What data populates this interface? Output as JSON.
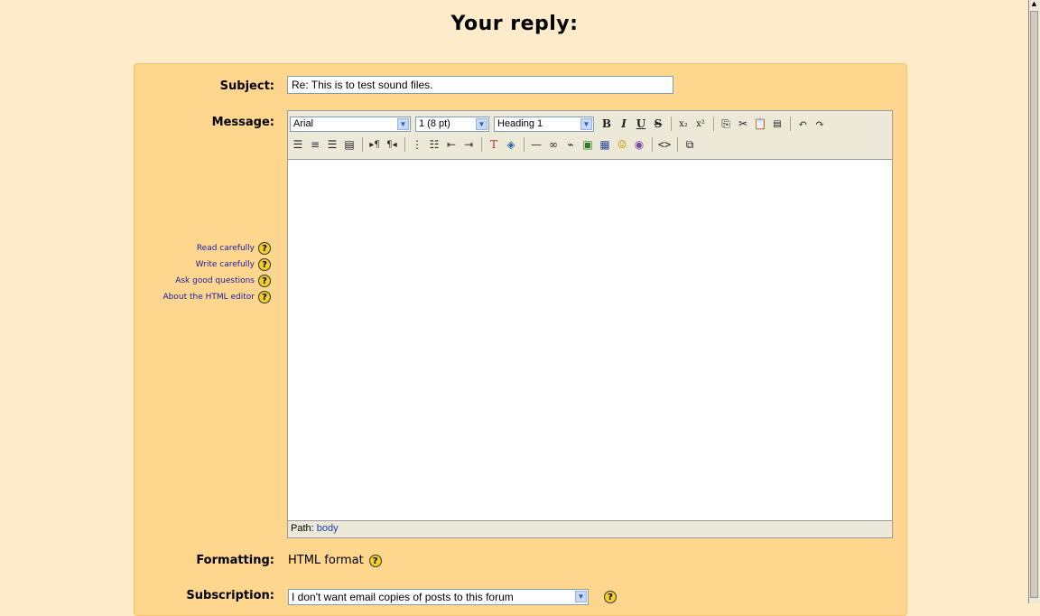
{
  "page": {
    "title": "Your reply:"
  },
  "form": {
    "subject_label": "Subject:",
    "subject_value": "Re: This is to test sound files.",
    "message_label": "Message:",
    "formatting_label": "Formatting:",
    "formatting_value": "HTML format",
    "subscription_label": "Subscription:",
    "subscription_value": "I don't want email copies of posts to this forum"
  },
  "editor": {
    "font": "Arial",
    "size": "1 (8 pt)",
    "format": "Heading 1",
    "path_label": "Path:",
    "path_value": "body"
  },
  "help": {
    "links": [
      "Read carefully",
      "Write carefully",
      "Ask good questions",
      "About the HTML editor"
    ],
    "icon": "?"
  },
  "colors": {
    "background": "#fdebc9",
    "panel": "#fed68e",
    "link": "#1a1aa6"
  }
}
